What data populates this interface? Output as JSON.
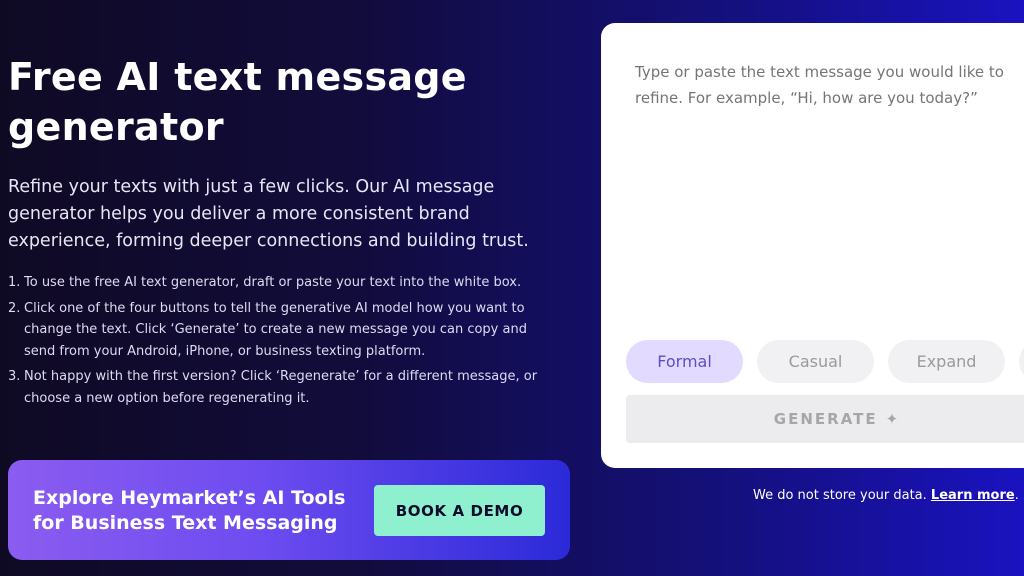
{
  "hero": {
    "title": "Free AI text message generator",
    "subtitle": "Refine your texts with just a few clicks. Our AI message generator helps you deliver a more consistent brand experience, forming deeper connections and building trust."
  },
  "steps": [
    {
      "num": "1.",
      "text": "To use the free AI text generator, draft or paste your text into the white box."
    },
    {
      "num": "2.",
      "text": "Click one of the four buttons to tell the generative AI model how you want to change the text. Click ‘Generate’ to create a new message you can copy and send from your Android, iPhone, or business texting platform."
    },
    {
      "num": "3.",
      "text": "Not happy with the first version? Click ‘Regenerate’ for a different message, or choose a new option before regenerating it."
    }
  ],
  "cta": {
    "text": "Explore Heymarket’s AI Tools for Business Text Messaging",
    "button_label": "BOOK A DEMO"
  },
  "generator": {
    "placeholder": "Type or paste the text message you would like to refine. For example, “Hi, how are you today?”",
    "options": [
      {
        "label": "Formal",
        "active": true
      },
      {
        "label": "Casual",
        "active": false
      },
      {
        "label": "Expand",
        "active": false
      }
    ],
    "generate_label": "GENERATE",
    "generate_icon": "✦"
  },
  "privacy": {
    "text": "We do not store your data.",
    "link": "Learn more"
  },
  "colors": {
    "cta_button": "#8ff0d0",
    "active_option": "#e3dbff",
    "active_option_text": "#5b4ec6"
  }
}
